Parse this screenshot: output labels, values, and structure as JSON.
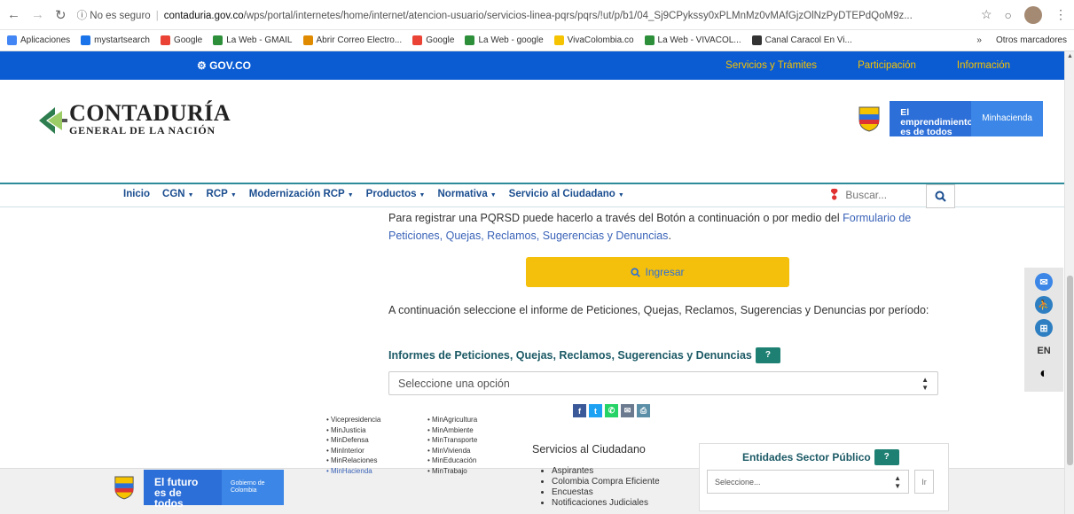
{
  "browser": {
    "security": "No es seguro",
    "host": "contaduria.gov.co",
    "path": "/wps/portal/internetes/home/internet/atencion-usuario/servicios-linea-pqrs/pqrs/!ut/p/b1/04_Sj9CPykssy0xPLMnMz0vMAfGjzOlNzPyDTEPdQoM9z...",
    "bookmarks": [
      {
        "label": "Aplicaciones",
        "icon": "apps-grid-icon",
        "color": "#4285f4"
      },
      {
        "label": "mystartsearch",
        "icon": "s-logo-icon",
        "color": "#1a73e8"
      },
      {
        "label": "Google",
        "icon": "google-g-icon",
        "color": "#ea4335"
      },
      {
        "label": "La Web - GMAIL",
        "icon": "globe-icon",
        "color": "#2d8f3a"
      },
      {
        "label": "Abrir Correo Electro...",
        "icon": "mail-icon",
        "color": "#e08a00"
      },
      {
        "label": "Google",
        "icon": "google-g-icon",
        "color": "#ea4335"
      },
      {
        "label": "La Web - google",
        "icon": "globe-icon",
        "color": "#2d8f3a"
      },
      {
        "label": "VivaColombia.co",
        "icon": "viva-icon",
        "color": "#f5c300"
      },
      {
        "label": "La Web - VIVACOL...",
        "icon": "globe-icon",
        "color": "#2d8f3a"
      },
      {
        "label": "Canal Caracol En Vi...",
        "icon": "caracol-icon",
        "color": "#333333"
      }
    ],
    "more_label": "»",
    "other_bookmarks": "Otros marcadores"
  },
  "gov": {
    "logo": "GOV.CO",
    "links": [
      "Servicios y Trámites",
      "Participación",
      "Información"
    ]
  },
  "brand": {
    "line1": "CONTADURÍA",
    "line2": "GENERAL DE LA NACIÓN",
    "emp_line": "El emprendimiento es de todos",
    "emp_ministry": "Minhacienda"
  },
  "menu": {
    "items": [
      {
        "label": "Inicio",
        "dropdown": false
      },
      {
        "label": "CGN",
        "dropdown": true
      },
      {
        "label": "RCP",
        "dropdown": true
      },
      {
        "label": "Modernización RCP",
        "dropdown": true
      },
      {
        "label": "Productos",
        "dropdown": true
      },
      {
        "label": "Normativa",
        "dropdown": true
      },
      {
        "label": "Servicio al Ciudadano",
        "dropdown": true
      }
    ],
    "search_placeholder": "Buscar..."
  },
  "main": {
    "intro_text": "Para registrar una PQRSD puede hacerlo a través del Botón a continuación o por medio del ",
    "intro_link": "Formulario de Peticiones, Quejas, Reclamos, Sugerencias y Denuncias",
    "intro_end": ".",
    "ingresar_label": "Ingresar",
    "period_text": "A continuación seleccione el informe de Peticiones, Quejas, Reclamos, Sugerencias y Denuncias por período:",
    "informes_title": "Informes de Peticiones, Quejas, Reclamos, Sugerencias y Denuncias",
    "help_badge": "?",
    "select_value": "Seleccione una opción"
  },
  "share": [
    {
      "icon": "facebook-icon",
      "glyph": "f",
      "color": "#3b5998"
    },
    {
      "icon": "twitter-icon",
      "glyph": "t",
      "color": "#1da1f2"
    },
    {
      "icon": "whatsapp-icon",
      "glyph": "✆",
      "color": "#25d366"
    },
    {
      "icon": "email-icon",
      "glyph": "✉",
      "color": "#6b7a8f"
    },
    {
      "icon": "print-icon",
      "glyph": "⎙",
      "color": "#5b8fa8"
    }
  ],
  "accessibility": {
    "items": [
      {
        "icon": "mail-contact-icon"
      },
      {
        "icon": "accessibility-people-icon"
      },
      {
        "icon": "sitemap-icon"
      },
      {
        "icon": "language-en-icon",
        "text": "EN"
      },
      {
        "icon": "contrast-icon"
      }
    ]
  },
  "footer": {
    "futuro_line": "El futuro es de todos",
    "gobierno": "Gobierno de Colombia",
    "col1": [
      "Vicepresidencia",
      "MinJusticia",
      "MinDefensa",
      "MinInterior",
      "MinRelaciones",
      "MinHacienda"
    ],
    "col2": [
      "MinAgricultura",
      "MinAmbiente",
      "MinTransporte",
      "MinVivienda",
      "MinEducación",
      "MinTrabajo"
    ],
    "servicios_title": "Servicios al Ciudadano",
    "servicios": [
      "Aspirantes",
      "Colombia Compra Eficiente",
      "Encuestas",
      "Notificaciones Judiciales"
    ],
    "entidades_title": "Entidades Sector Público",
    "entidades_select": "Seleccione...",
    "ir_label": "Ir"
  }
}
